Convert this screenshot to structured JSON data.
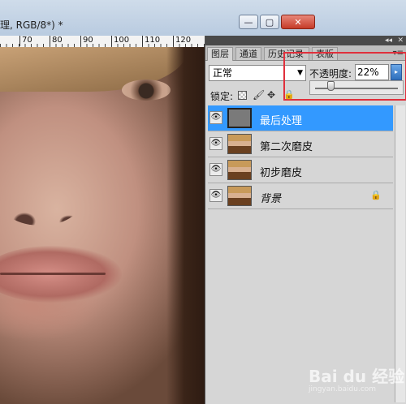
{
  "document": {
    "title": "理, RGB/8*) *",
    "minimize_glyph": "—",
    "maximize_glyph": "▢",
    "close_glyph": "✕"
  },
  "ruler": {
    "ticks": [
      "70",
      "80",
      "90",
      "100",
      "110",
      "120"
    ]
  },
  "panel": {
    "collapse_glyph": "◂◂",
    "close_glyph": "✕",
    "tabs": [
      {
        "label": "图层",
        "active": true
      },
      {
        "label": "通道",
        "active": false
      },
      {
        "label": "历史记录",
        "active": false
      },
      {
        "label": "表版",
        "active": false
      }
    ],
    "menu_glyph": "▾≡",
    "blend_mode": "正常",
    "blend_arrow": "▼",
    "opacity": {
      "label": "不透明度:",
      "value": "22%",
      "button_glyph": "▸"
    },
    "lock": {
      "label": "锁定:",
      "paint_glyph": "🖌",
      "move_glyph": "✥",
      "all_glyph": "🔒"
    },
    "layers": [
      {
        "name": "最后处理",
        "selected": true,
        "thumb": "gray",
        "locked": false
      },
      {
        "name": "第二次磨皮",
        "selected": false,
        "thumb": "photo",
        "locked": false
      },
      {
        "name": "初步磨皮",
        "selected": false,
        "thumb": "photo",
        "locked": false
      },
      {
        "name": "背景",
        "selected": false,
        "thumb": "photo",
        "locked": true,
        "italic": true
      }
    ],
    "eye_glyph": "👁",
    "lock_glyph": "🔒"
  },
  "watermark": {
    "text": "Bai du 经验",
    "sub": "jingyan.baidu.com"
  }
}
